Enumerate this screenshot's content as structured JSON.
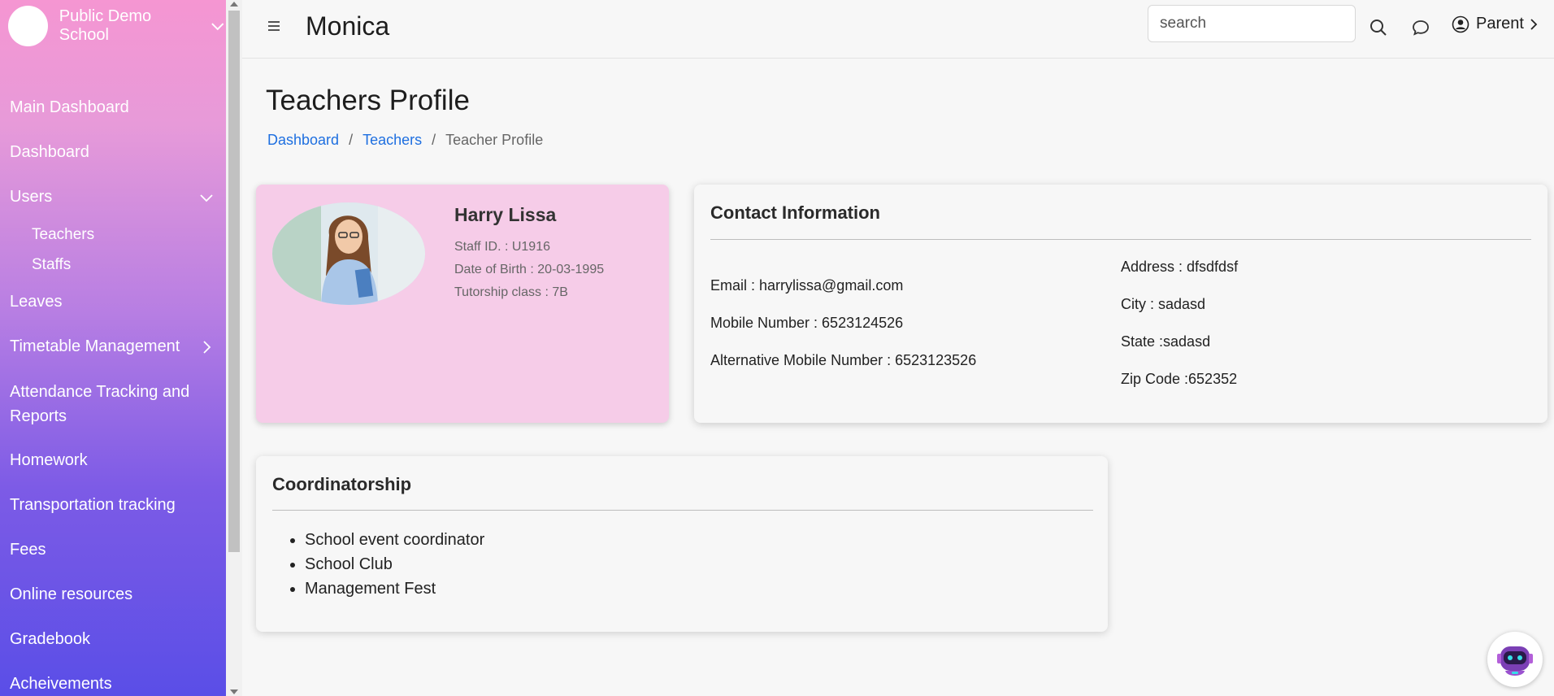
{
  "sidebar": {
    "school_name": "Public Demo School",
    "items": [
      {
        "label": "Main Dashboard"
      },
      {
        "label": "Dashboard"
      },
      {
        "label": "Users"
      },
      {
        "label": "Leaves"
      },
      {
        "label": "Timetable Management"
      },
      {
        "label": "Attendance Tracking and Reports"
      },
      {
        "label": "Homework"
      },
      {
        "label": "Transportation tracking"
      },
      {
        "label": "Fees"
      },
      {
        "label": "Online resources"
      },
      {
        "label": "Gradebook"
      },
      {
        "label": "Acheivements"
      }
    ],
    "users_sub": [
      {
        "label": "Teachers"
      },
      {
        "label": "Staffs"
      }
    ]
  },
  "header": {
    "title": "Monica",
    "search_placeholder": "search",
    "user_label": "Parent"
  },
  "page": {
    "title": "Teachers Profile",
    "breadcrumb": [
      "Dashboard",
      "Teachers",
      "Teacher Profile"
    ]
  },
  "profile": {
    "name": "Harry Lissa",
    "staff_id": "Staff ID. : U1916",
    "dob": "Date of Birth : 20-03-1995",
    "tutorship": "Tutorship class : 7B"
  },
  "contact": {
    "title": "Contact Information",
    "email": "Email : harrylissa@gmail.com",
    "mobile": "Mobile Number : 6523124526",
    "alt_mobile": "Alternative Mobile Number : 6523123526",
    "address": "Address : dfsdfdsf",
    "city": "City : sadasd",
    "state": "State :sadasd",
    "zip": "Zip Code :652352"
  },
  "coordinatorship": {
    "title": "Coordinatorship",
    "items": [
      "School event coordinator",
      "School Club",
      "Management Fest"
    ]
  },
  "colors": {
    "sidebar_top": "#f596d2",
    "sidebar_bottom": "#5a4ee7",
    "profile_card": "#f6cce8",
    "link": "#1e6fe0"
  }
}
